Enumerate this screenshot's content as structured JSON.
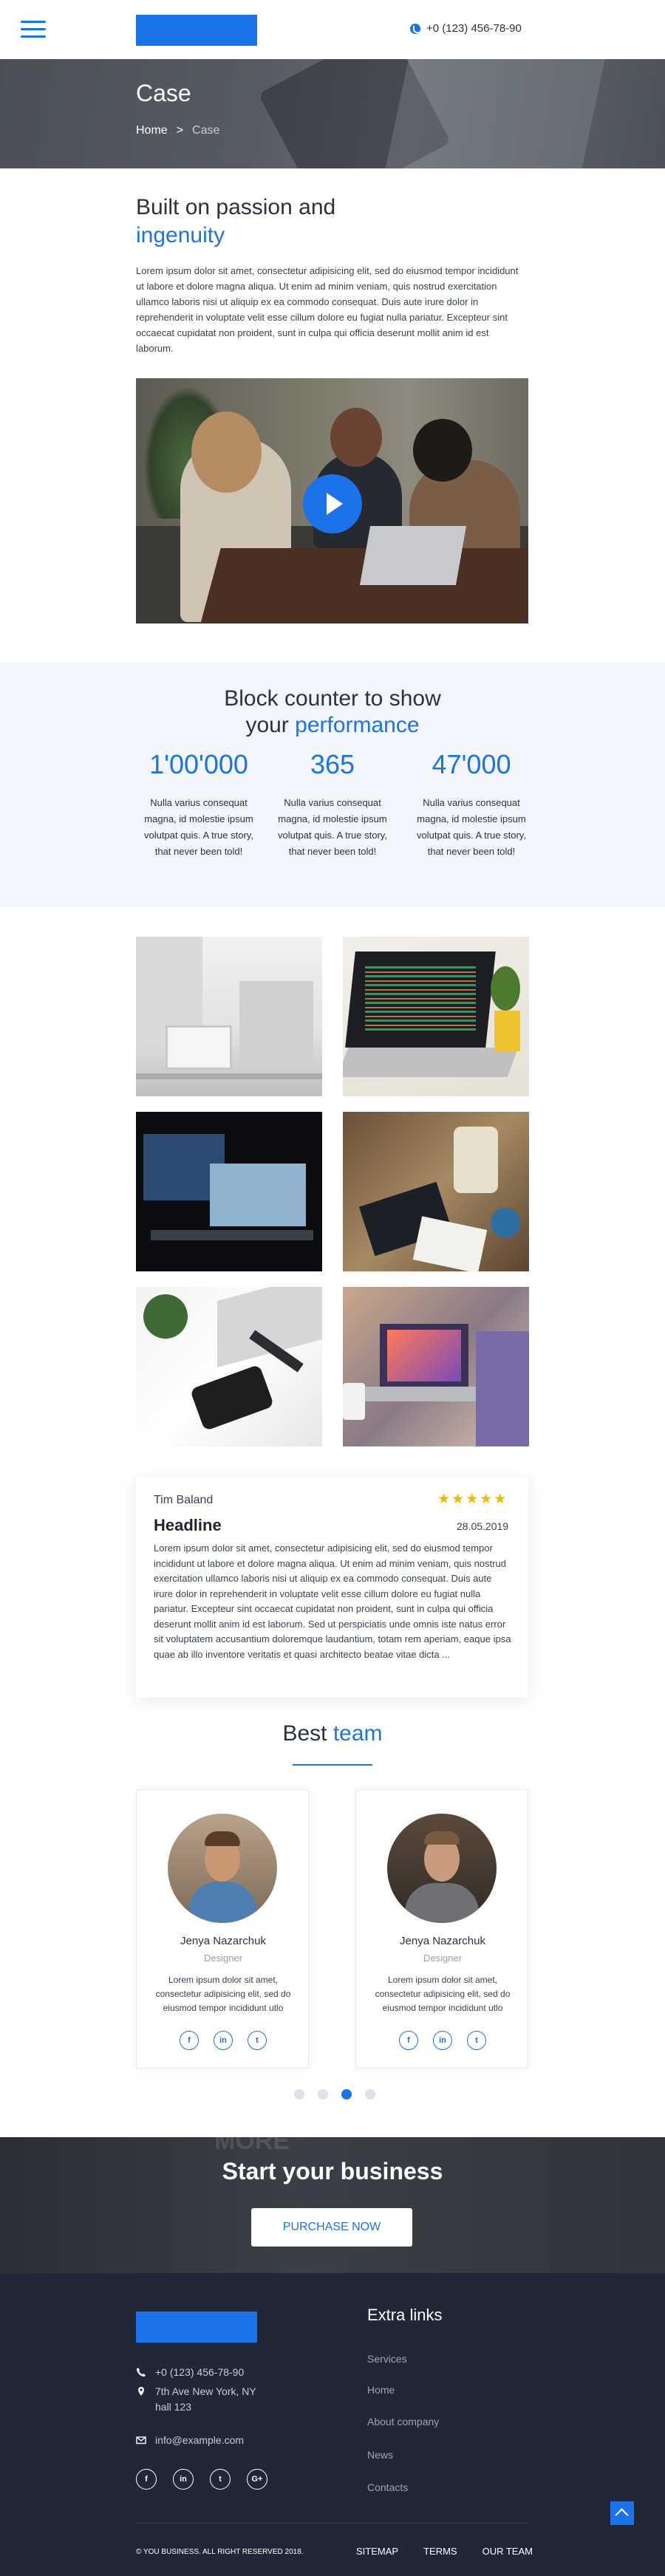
{
  "header": {
    "phone": "+0 (123) 456-78-90"
  },
  "hero": {
    "title": "Case",
    "breadcrumb": {
      "home": "Home",
      "separator": ">",
      "current": "Case"
    }
  },
  "intro": {
    "title_line1": "Built on passion and",
    "title_accent": "ingenuity",
    "paragraph": "Lorem ipsum dolor sit amet, consectetur adipisicing elit, sed do eiusmod tempor incididunt ut labore et dolore magna aliqua. Ut enim ad minim veniam, quis nostrud exercitation ullamco laboris nisi ut aliquip ex ea commodo consequat. Duis aute irure dolor in reprehenderit in voluptate velit esse cillum dolore eu fugiat nulla pariatur. Excepteur sint occaecat cupidatat non proident, sunt in culpa qui officia deserunt mollit anim id est laborum."
  },
  "counter": {
    "title_line1": "Block counter to show",
    "title_line2_prefix": "your ",
    "title_accent": "performance",
    "stats": [
      {
        "value": "1'00'000",
        "text": "Nulla varius consequat magna, id molestie ipsum volutpat quis. A true story, that never been told!"
      },
      {
        "value": "365",
        "text": "Nulla varius consequat magna, id molestie ipsum volutpat quis. A true story, that never been told!"
      },
      {
        "value": "47'000",
        "text": "Nulla varius consequat magna, id molestie ipsum volutpat quis. A true story, that never been told!"
      }
    ]
  },
  "review": {
    "author": "Tim Baland",
    "stars": "★★★★★",
    "rating": 5,
    "headline": "Headline",
    "date": "28.05.2019",
    "text": "Lorem ipsum dolor sit amet, consectetur adipisicing elit, sed do eiusmod tempor incididunt ut labore et dolore magna aliqua. Ut enim ad minim veniam, quis nostrud exercitation ullamco laboris nisi ut aliquip ex ea commodo consequat. Duis aute irure dolor in reprehenderit in voluptate velit esse cillum dolore eu fugiat nulla pariatur. Excepteur sint occaecat cupidatat non proident, sunt in culpa qui officia deserunt mollit anim id est laborum. Sed ut perspiciatis unde omnis iste natus error sit voluptatem accusantium doloremque laudantium, totam rem aperiam, eaque ipsa quae ab illo inventore veritatis et quasi architecto beatae vitae dicta ..."
  },
  "team": {
    "title_prefix": "Best ",
    "title_accent": "team",
    "members": [
      {
        "name": "Jenya Nazarchuk",
        "role": "Designer",
        "bio": "Lorem ipsum dolor sit amet, consectetur adipisicing elit, sed do eiusmod tempor incididunt utlo"
      },
      {
        "name": "Jenya Nazarchuk",
        "role": "Designer",
        "bio": "Lorem ipsum dolor sit amet, consectetur adipisicing elit, sed do eiusmod tempor incididunt utlo"
      }
    ],
    "social_icons": [
      "facebook-icon",
      "linkedin-icon",
      "twitter-icon"
    ],
    "active_slide": 3,
    "slide_count": 4
  },
  "cta": {
    "background_word": "MORE",
    "title": "Start your business",
    "button": "PURCHASE NOW"
  },
  "footer": {
    "phone": "+0 (123) 456-78-90",
    "address_line1": "7th Ave New York, NY",
    "address_line2": "hall 123",
    "email": "info@example.com",
    "social_icons": [
      "facebook-icon",
      "linkedin-icon",
      "twitter-icon",
      "googleplus-icon"
    ],
    "links_title": "Extra links",
    "links": [
      "Services",
      "Home",
      "About company",
      "News",
      "Contacts"
    ],
    "copyright": "© YOU BUSINESS. ALL RIGHT RESERVED 2018.",
    "nav": [
      "SITEMAP",
      "TERMS",
      "OUR TEAM"
    ]
  },
  "colors": {
    "accent": "#1a73e8",
    "footer_bg": "#222737",
    "counter_bg": "#f3f7fd",
    "star": "#f5b800"
  }
}
